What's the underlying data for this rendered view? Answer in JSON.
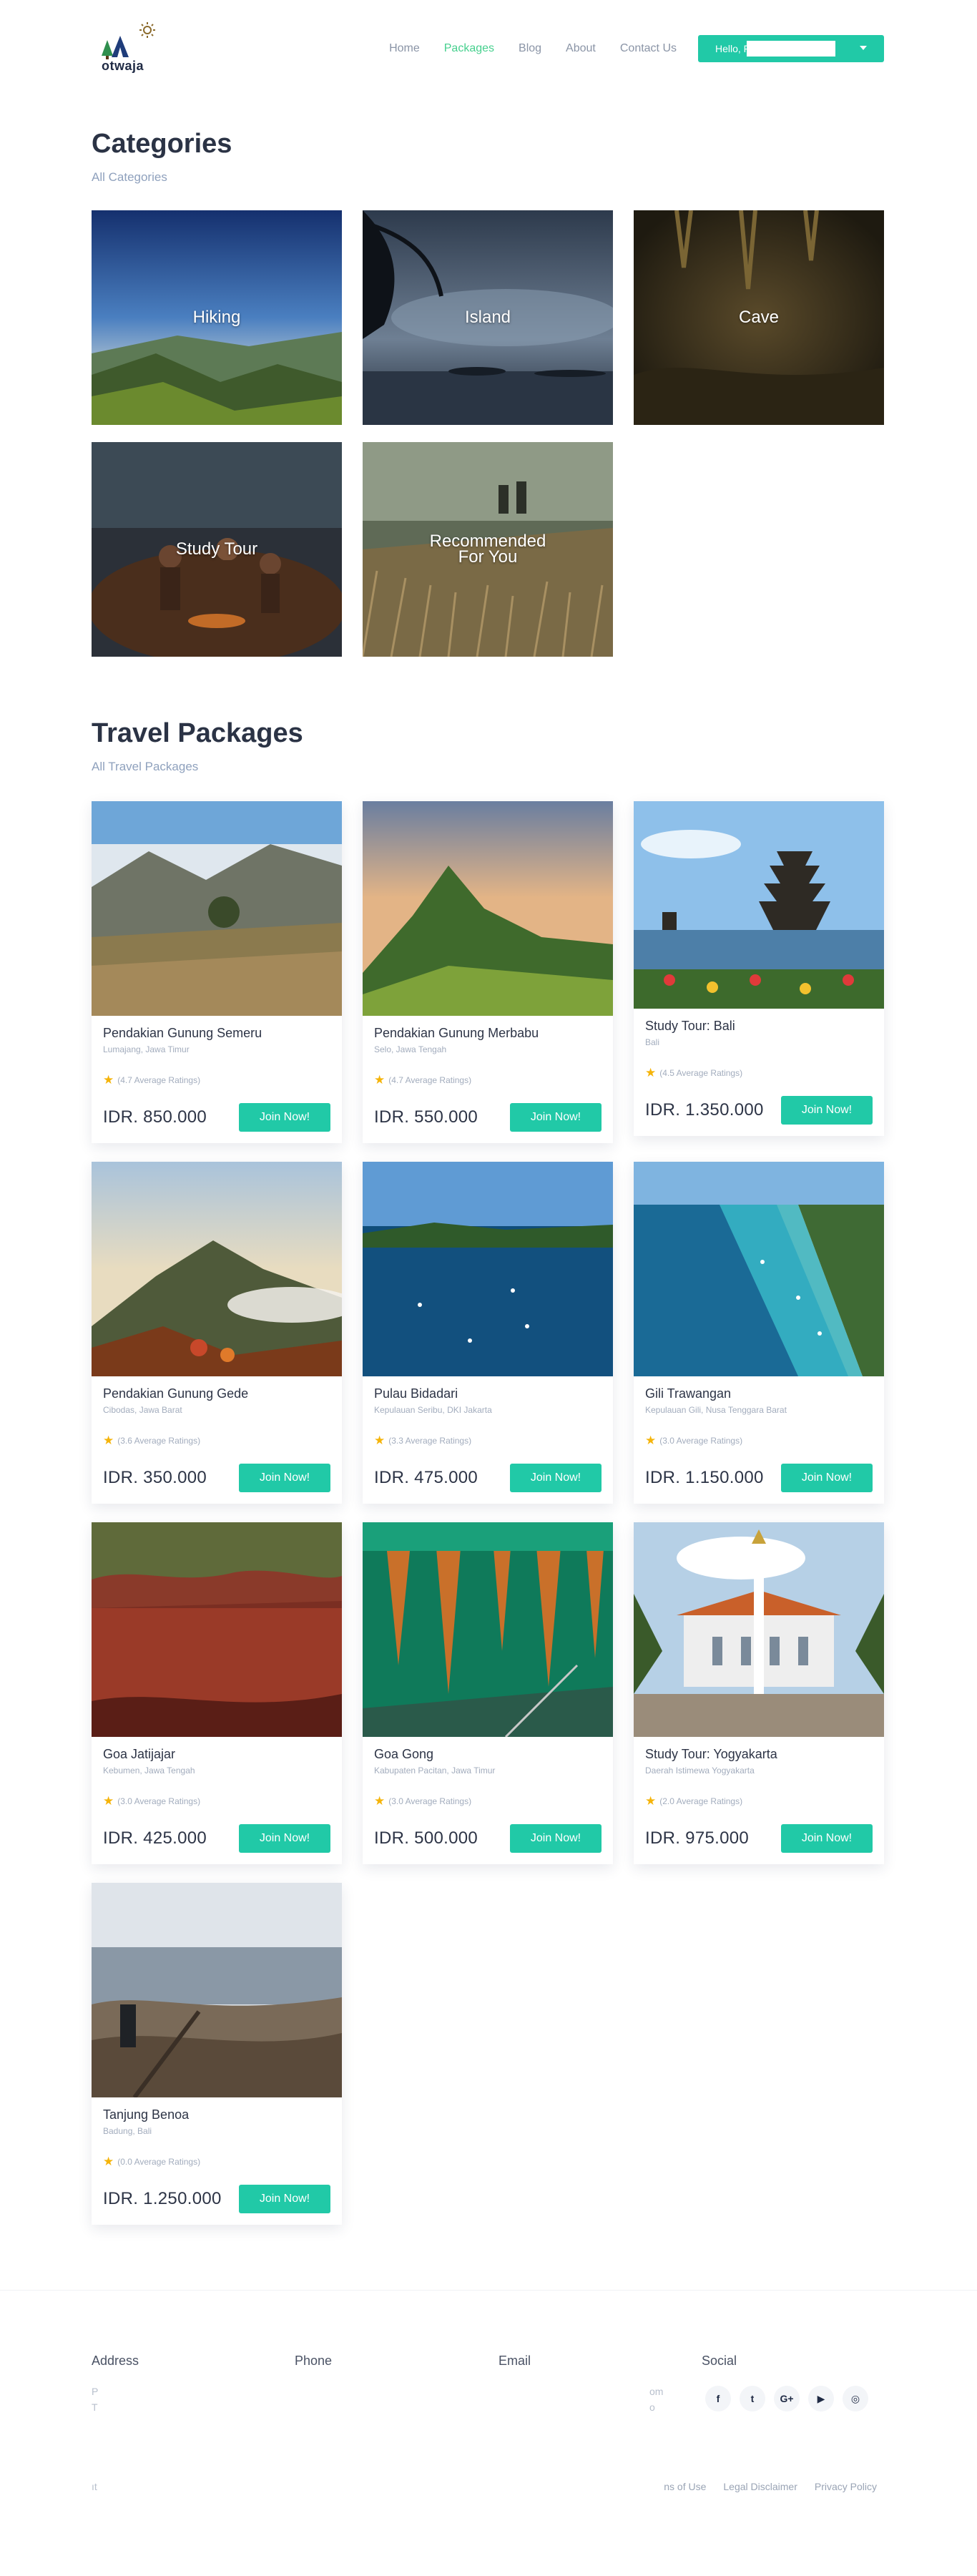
{
  "header": {
    "logo_text": "otwaja",
    "nav": [
      "Home",
      "Packages",
      "Blog",
      "About",
      "Contact Us"
    ],
    "active_nav": "Packages",
    "user_greeting": "Hello, F"
  },
  "categories": {
    "title": "Categories",
    "subtitle": "All Categories",
    "items": [
      {
        "label": "Hiking"
      },
      {
        "label": "Island"
      },
      {
        "label": "Cave"
      },
      {
        "label": "Study Tour"
      },
      {
        "label": "Recommended\nFor You"
      }
    ]
  },
  "packages": {
    "title": "Travel Packages",
    "subtitle": "All Travel Packages",
    "join_label": "Join Now!",
    "items": [
      {
        "name": "Pendakian Gunung Semeru",
        "location": "Lumajang, Jawa Timur",
        "rating": "(4.7 Average Ratings)",
        "price": "IDR. 850.000"
      },
      {
        "name": "Pendakian Gunung Merbabu",
        "location": "Selo, Jawa Tengah",
        "rating": "(4.7 Average Ratings)",
        "price": "IDR. 550.000"
      },
      {
        "name": "Study Tour: Bali",
        "location": "Bali",
        "rating": "(4.5 Average Ratings)",
        "price": "IDR. 1.350.000"
      },
      {
        "name": "Pendakian Gunung Gede",
        "location": "Cibodas, Jawa Barat",
        "rating": "(3.6 Average Ratings)",
        "price": "IDR. 350.000"
      },
      {
        "name": "Pulau Bidadari",
        "location": "Kepulauan Seribu, DKI Jakarta",
        "rating": "(3.3 Average Ratings)",
        "price": "IDR. 475.000"
      },
      {
        "name": "Gili Trawangan",
        "location": "Kepulauan Gili, Nusa Tenggara Barat",
        "rating": "(3.0 Average Ratings)",
        "price": "IDR. 1.150.000"
      },
      {
        "name": "Goa Jatijajar",
        "location": "Kebumen, Jawa Tengah",
        "rating": "(3.0 Average Ratings)",
        "price": "IDR. 425.000"
      },
      {
        "name": "Goa Gong",
        "location": "Kabupaten Pacitan, Jawa Timur",
        "rating": "(3.0 Average Ratings)",
        "price": "IDR. 500.000"
      },
      {
        "name": "Study Tour: Yogyakarta",
        "location": "Daerah Istimewa Yogyakarta",
        "rating": "(2.0 Average Ratings)",
        "price": "IDR. 975.000"
      },
      {
        "name": "Tanjung Benoa",
        "location": "Badung, Bali",
        "rating": "(0.0 Average Ratings)",
        "price": "IDR. 1.250.000"
      }
    ]
  },
  "footer": {
    "address_title": "Address",
    "phone_title": "Phone",
    "email_title": "Email",
    "social_title": "Social",
    "address_line1": "P",
    "address_line2": "T",
    "email_line1": "om",
    "email_line2": "o",
    "social_icons": [
      "facebook-icon",
      "twitter-icon",
      "google-plus-icon",
      "youtube-icon",
      "instagram-icon"
    ],
    "social_glyphs": [
      "f",
      "t",
      "G+",
      "▶",
      "◎"
    ],
    "copyright": "ıt",
    "links": [
      "ns of Use",
      "Legal Disclaimer",
      "Privacy Policy"
    ]
  }
}
